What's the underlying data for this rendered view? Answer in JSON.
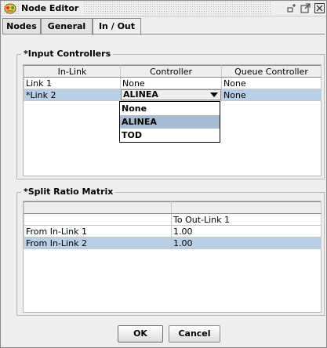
{
  "window": {
    "title": "Node Editor"
  },
  "tabs": [
    "Nodes",
    "General",
    "In / Out"
  ],
  "input_controllers": {
    "title": "*Input Controllers",
    "columns": [
      "In-Link",
      "Controller",
      "Queue Controller"
    ],
    "rows": [
      {
        "link": "Link 1",
        "controller": "None",
        "queue": "None"
      },
      {
        "link": "*Link 2",
        "controller": "ALINEA",
        "queue": "None"
      }
    ],
    "dropdown_options": [
      "None",
      "ALINEA",
      "TOD"
    ],
    "dropdown_selected": "ALINEA"
  },
  "split_ratio": {
    "title": "*Split Ratio Matrix",
    "header_row": [
      "",
      "To Out-Link 1"
    ],
    "rows": [
      {
        "label": "From In-Link 1",
        "value": "1.00"
      },
      {
        "label": "From In-Link 2",
        "value": "1.00"
      }
    ]
  },
  "buttons": {
    "ok": "OK",
    "cancel": "Cancel"
  },
  "colors": {
    "selection": "#b8cfe5",
    "dropdown_selection": "#a7bcd3",
    "background": "#eeeeee"
  }
}
